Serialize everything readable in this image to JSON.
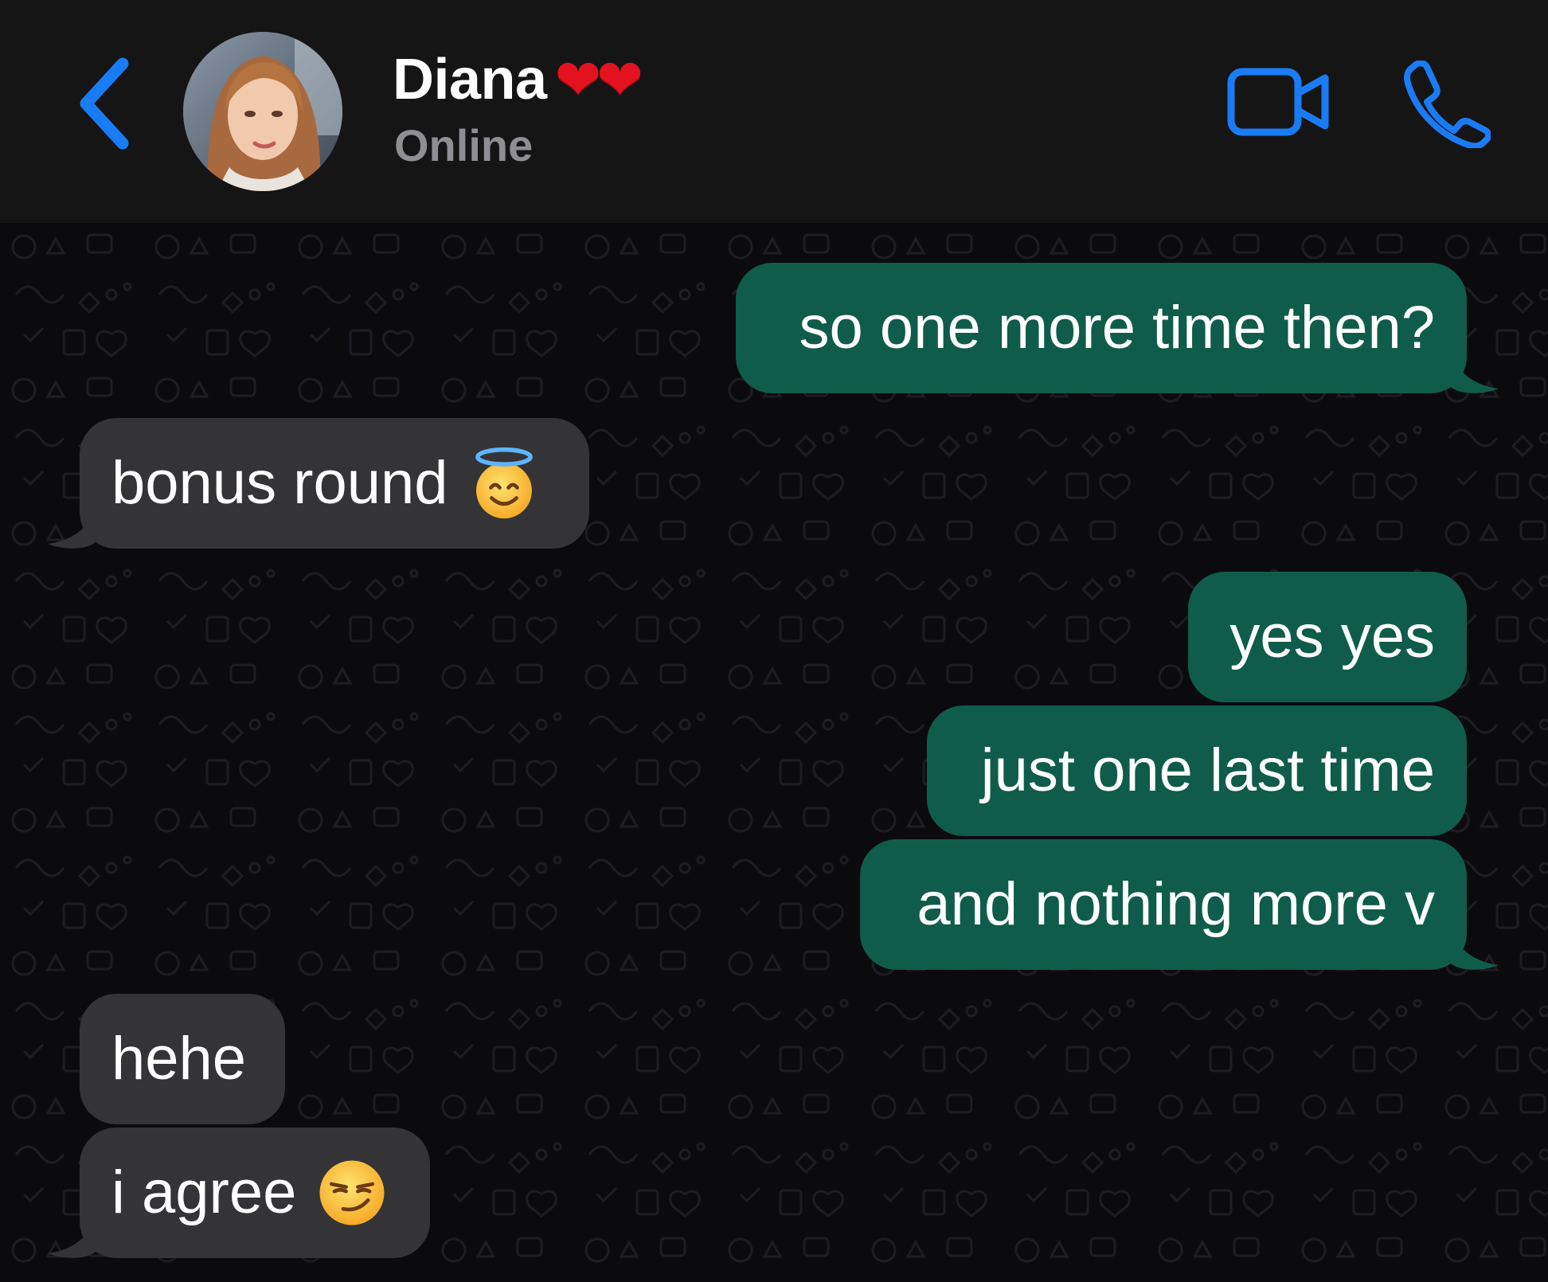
{
  "header": {
    "contact_name": "Diana",
    "name_emoji": "❤❤",
    "status": "Online",
    "icons": {
      "back": "chevron-left-icon",
      "video": "video-camera-icon",
      "call": "phone-icon"
    },
    "accent_color": "#1a7cf5"
  },
  "messages": [
    {
      "direction": "outgoing",
      "text": "so one more time then?",
      "tail": true
    },
    {
      "direction": "incoming",
      "text": "bonus round",
      "emoji": "smiling-face-with-halo",
      "tail": true
    },
    {
      "direction": "outgoing",
      "text": "yes yes",
      "tail": false
    },
    {
      "direction": "outgoing",
      "text": "just one last time",
      "tail": false
    },
    {
      "direction": "outgoing",
      "text": "and nothing more v",
      "tail": true
    },
    {
      "direction": "incoming",
      "text": "hehe",
      "tail": false
    },
    {
      "direction": "incoming",
      "text": "i agree",
      "emoji": "smirking-face",
      "tail": true
    }
  ],
  "colors": {
    "header_bg": "#151516",
    "chat_bg": "#0b0b0e",
    "outgoing_bubble": "#0f5c4a",
    "incoming_bubble": "#343436",
    "status_text": "#8e8e93"
  }
}
